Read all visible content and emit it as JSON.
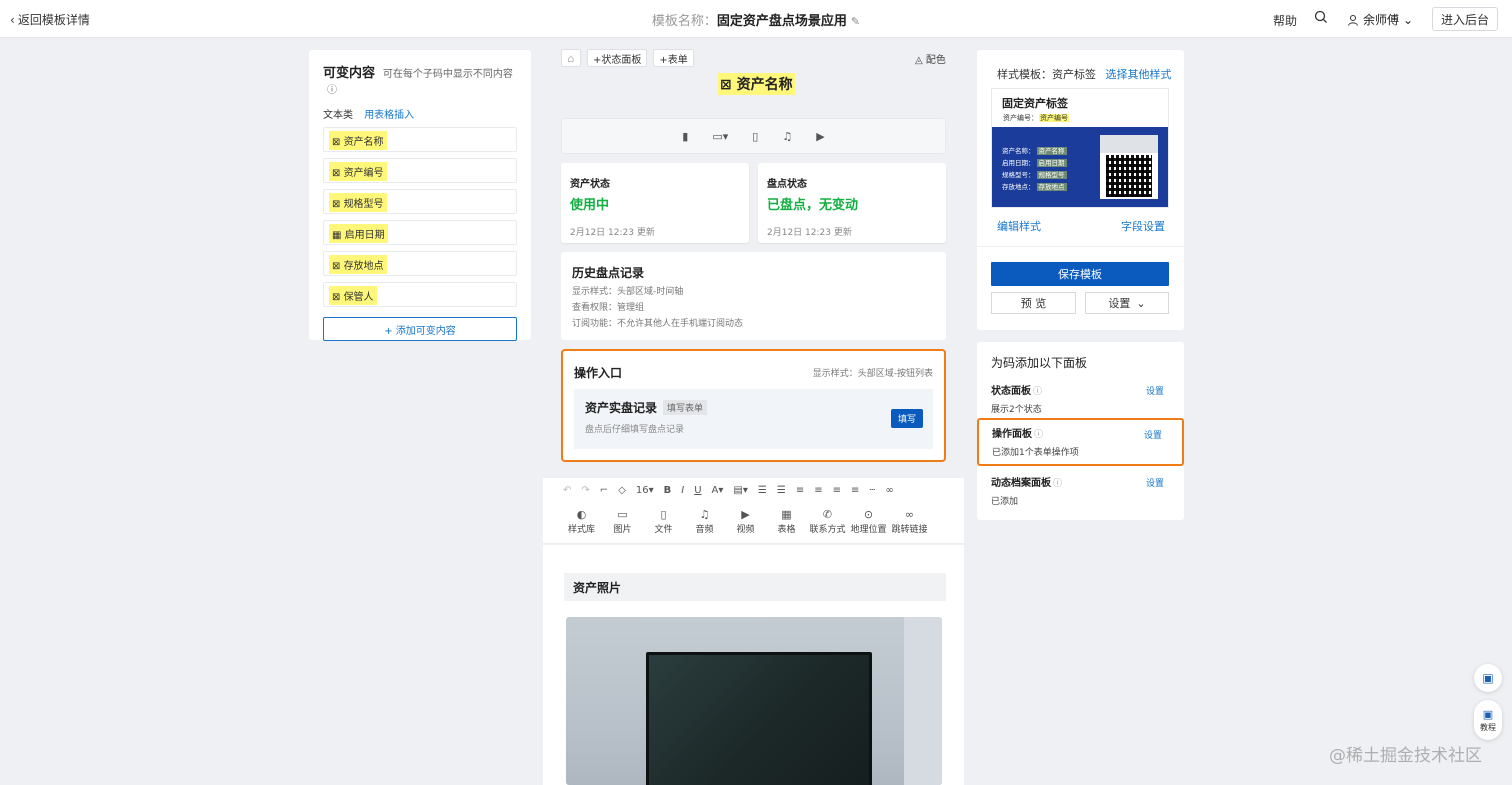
{
  "topbar": {
    "back_label": "返回模板详情",
    "template_label": "模板名称：",
    "template_name": "固定资产盘点场景应用",
    "help": "帮助",
    "user_name": "余师傅",
    "enter_backend": "进入后台"
  },
  "left": {
    "title": "可变内容",
    "hint": "可在每个子码中显示不同内容",
    "category": "文本类",
    "table_insert": "用表格插入",
    "items": [
      "资产名称",
      "资产编号",
      "规格型号",
      "启用日期",
      "存放地点",
      "保管人"
    ],
    "add_button": "+ 添加可变内容"
  },
  "center": {
    "status_panel_btn": "+状态面板",
    "form_btn": "+表单",
    "color_btn": "配色",
    "asset_title": "资产名称",
    "status_cards": [
      {
        "title": "资产状态",
        "value": "使用中",
        "updated": "2月12日 12:23 更新"
      },
      {
        "title": "盘点状态",
        "value": "已盘点，无变动",
        "updated": "2月12日 12:23 更新"
      }
    ],
    "history": {
      "title": "历史盘点记录",
      "lines": [
        "显示样式：头部区域-时间轴",
        "查看权限：管理组",
        "订阅功能：不允许其他人在手机端订阅动态"
      ]
    },
    "operation": {
      "title": "操作入口",
      "style": "显示样式：头部区域-按钮列表",
      "record_title": "资产实盘记录",
      "badge": "填写表单",
      "desc": "盘点后仔细填写盘点记录",
      "fill_button": "填写"
    },
    "editor": {
      "font_size": "16",
      "tools": [
        "样式库",
        "图片",
        "文件",
        "音频",
        "视频",
        "表格",
        "联系方式",
        "地理位置",
        "跳转链接"
      ]
    },
    "photo_title": "资产照片"
  },
  "right": {
    "style_template_label": "样式模板：资产标签",
    "choose_other": "选择其他样式",
    "label_card": {
      "title": "固定资产标签",
      "number_label": "资产编号：",
      "number_tag": "资产编号",
      "rows": [
        {
          "label": "资产名称：",
          "value": "资产名称"
        },
        {
          "label": "启用日期：",
          "value": "启用日期"
        },
        {
          "label": "规格型号：",
          "value": "规格型号"
        },
        {
          "label": "存放地点：",
          "value": "存放地点"
        }
      ]
    },
    "edit_style": "编辑样式",
    "field_settings": "字段设置",
    "save_template": "保存模板",
    "preview": "预 览",
    "settings": "设置",
    "add_panel_heading": "为码添加以下面板",
    "panels": [
      {
        "name": "状态面板",
        "desc": "展示2个状态",
        "action": "设置"
      },
      {
        "name": "操作面板",
        "desc": "已添加1个表单操作项",
        "action": "设置"
      },
      {
        "name": "动态档案面板",
        "desc": "已添加",
        "action": "设置"
      }
    ]
  },
  "floating": {
    "tutorial": "教程"
  },
  "watermark": "@稀土掘金技术社区",
  "colors": {
    "accent": "#1677cc",
    "primary_button": "#0b5bbe",
    "highlight": "#f07c17",
    "tag_yellow": "#fff77a",
    "status_green": "#12b042"
  }
}
